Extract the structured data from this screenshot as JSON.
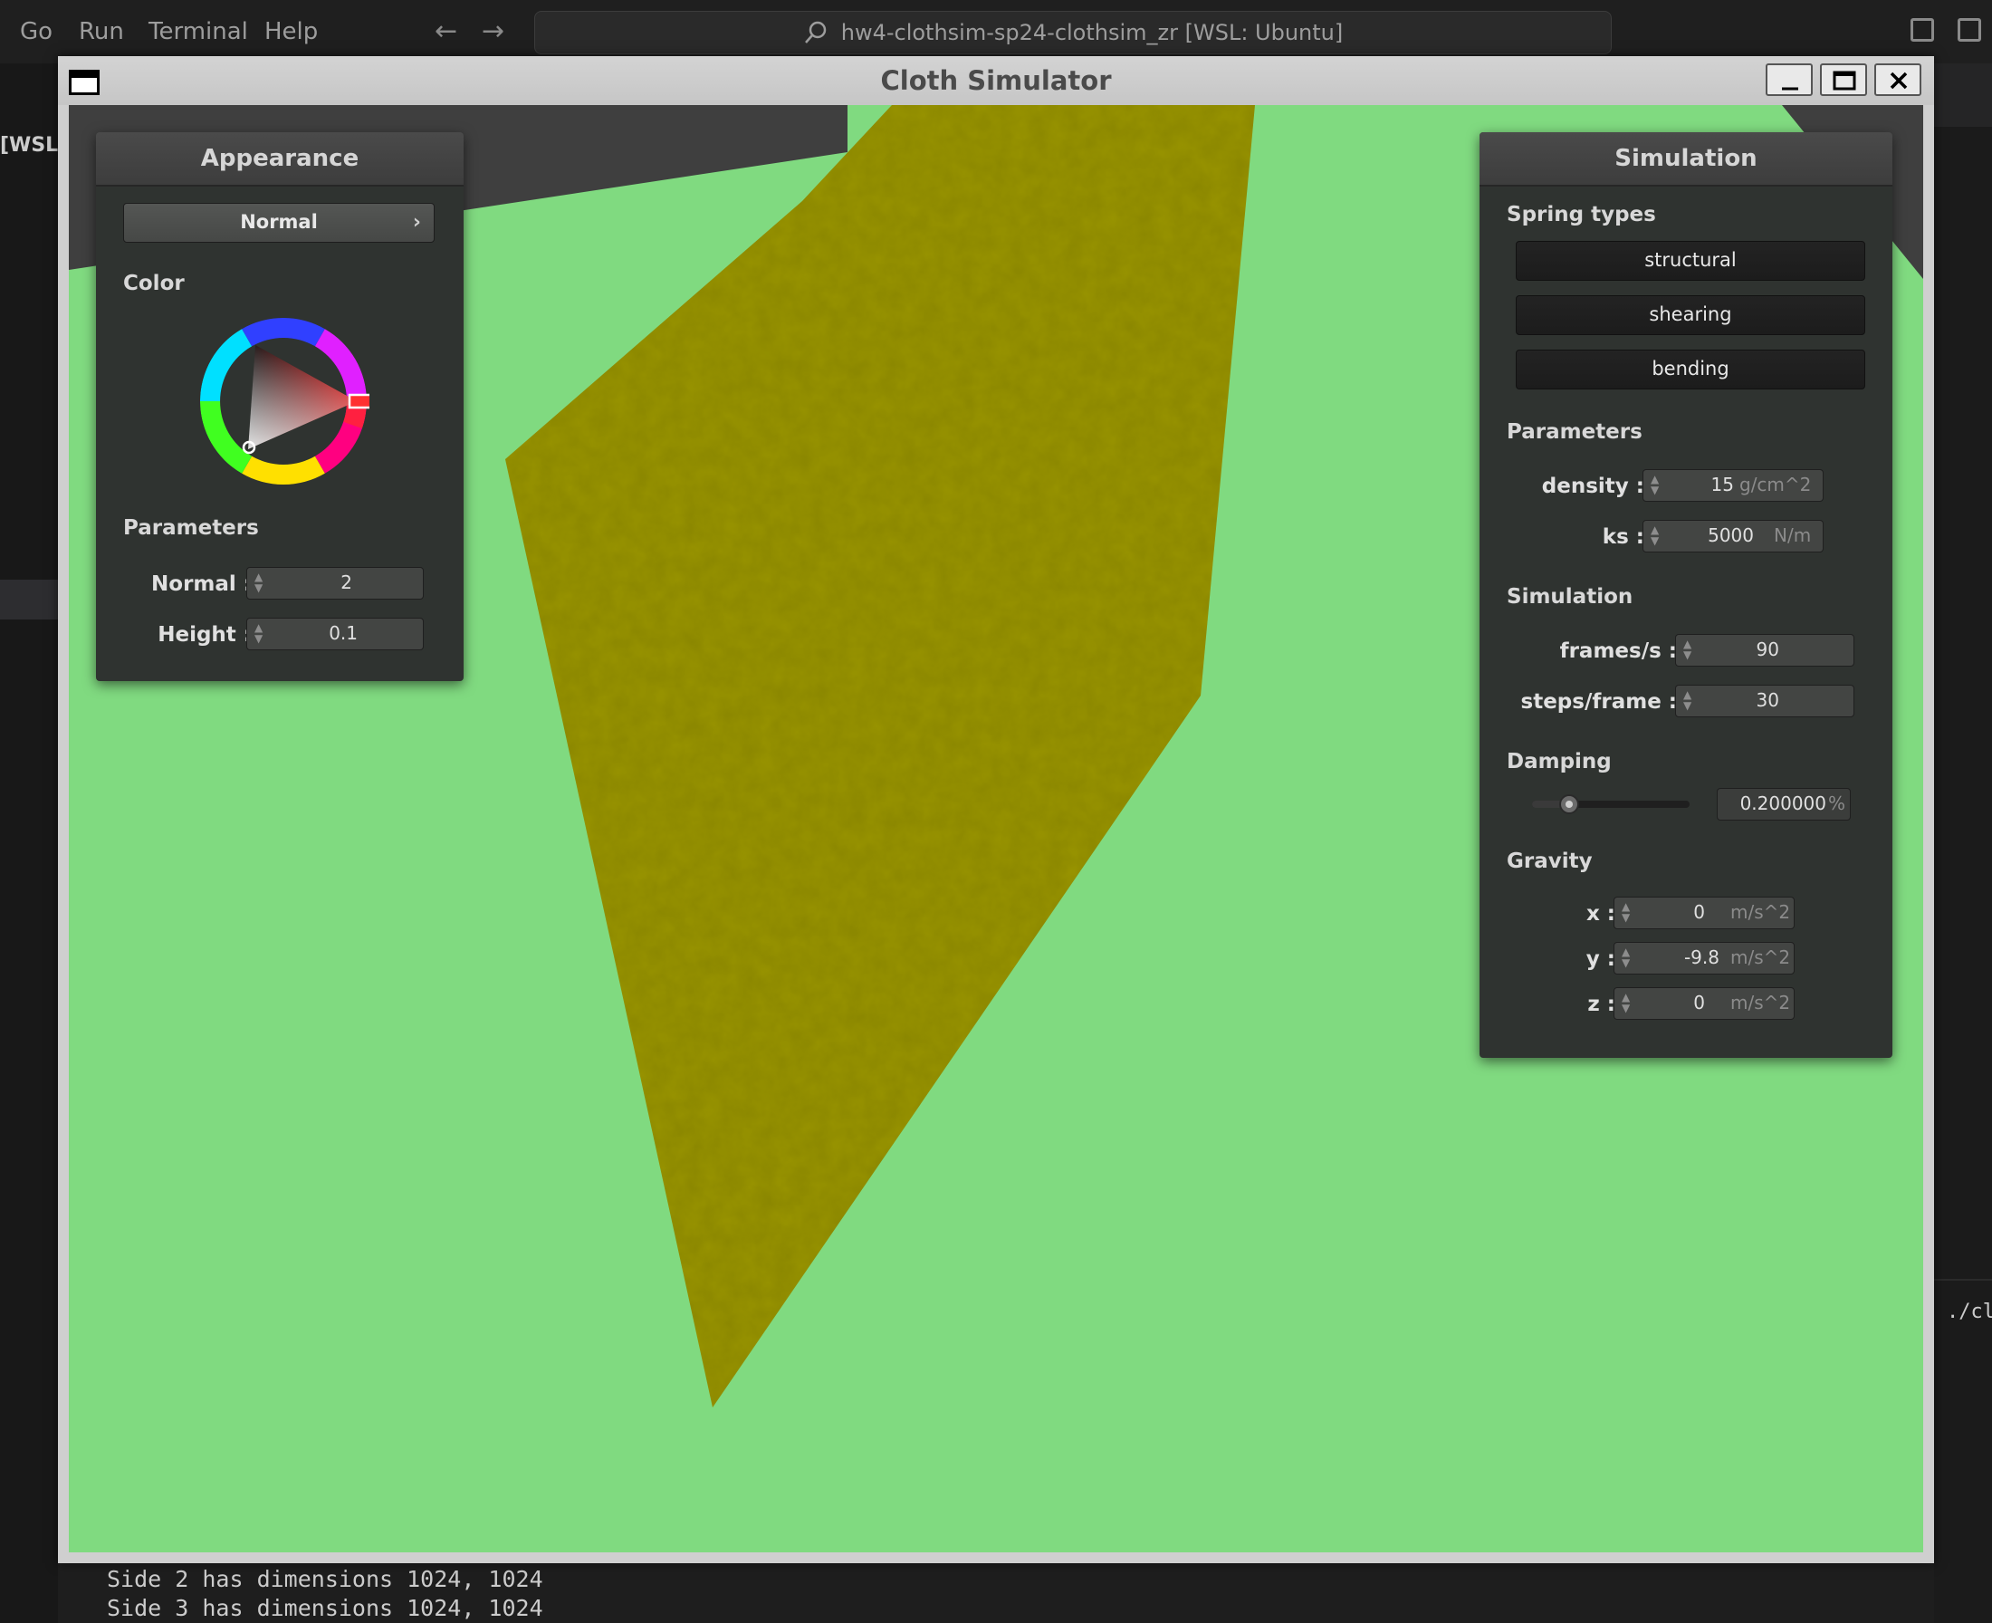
{
  "vscode": {
    "menu": [
      "Go",
      "Run",
      "Terminal",
      "Help"
    ],
    "search_text": "hw4-clothsim-sp24-clothsim_zr [WSL: Ubuntu]",
    "left_label": "[WSL..",
    "right_label": "./clot",
    "terminal_lines": [
      "Side 2 has dimensions 1024, 1024",
      "Side 3 has dimensions 1024, 1024"
    ]
  },
  "window": {
    "title": "Cloth Simulator"
  },
  "appearance": {
    "title": "Appearance",
    "shader_selected": "Normal",
    "color_label": "Color",
    "params_label": "Parameters",
    "normal_label": "Normal :",
    "normal_value": "2",
    "height_label": "Height :",
    "height_value": "0.1"
  },
  "simulation": {
    "title": "Simulation",
    "spring_types_label": "Spring types",
    "springs": [
      "structural",
      "shearing",
      "bending"
    ],
    "params_label": "Parameters",
    "density_label": "density :",
    "density_value": "15",
    "density_unit": "g/cm^2",
    "ks_label": "ks :",
    "ks_value": "5000",
    "ks_unit": "N/m",
    "sim_label": "Simulation",
    "fps_label": "frames/s :",
    "fps_value": "90",
    "steps_label": "steps/frame :",
    "steps_value": "30",
    "damping_label": "Damping",
    "damping_slider_fraction": 0.2,
    "damping_value": "0.200000",
    "damping_unit": "%",
    "gravity_label": "Gravity",
    "gx_label": "x :",
    "gx_value": "0",
    "gy_label": "y :",
    "gy_value": "-9.8",
    "gz_label": "z :",
    "gz_value": "0",
    "gravity_unit": "m/s^2"
  },
  "colors": {
    "background_green": "#80da80",
    "cloth": "#8a8600",
    "panel_bg": "#2f3330"
  }
}
